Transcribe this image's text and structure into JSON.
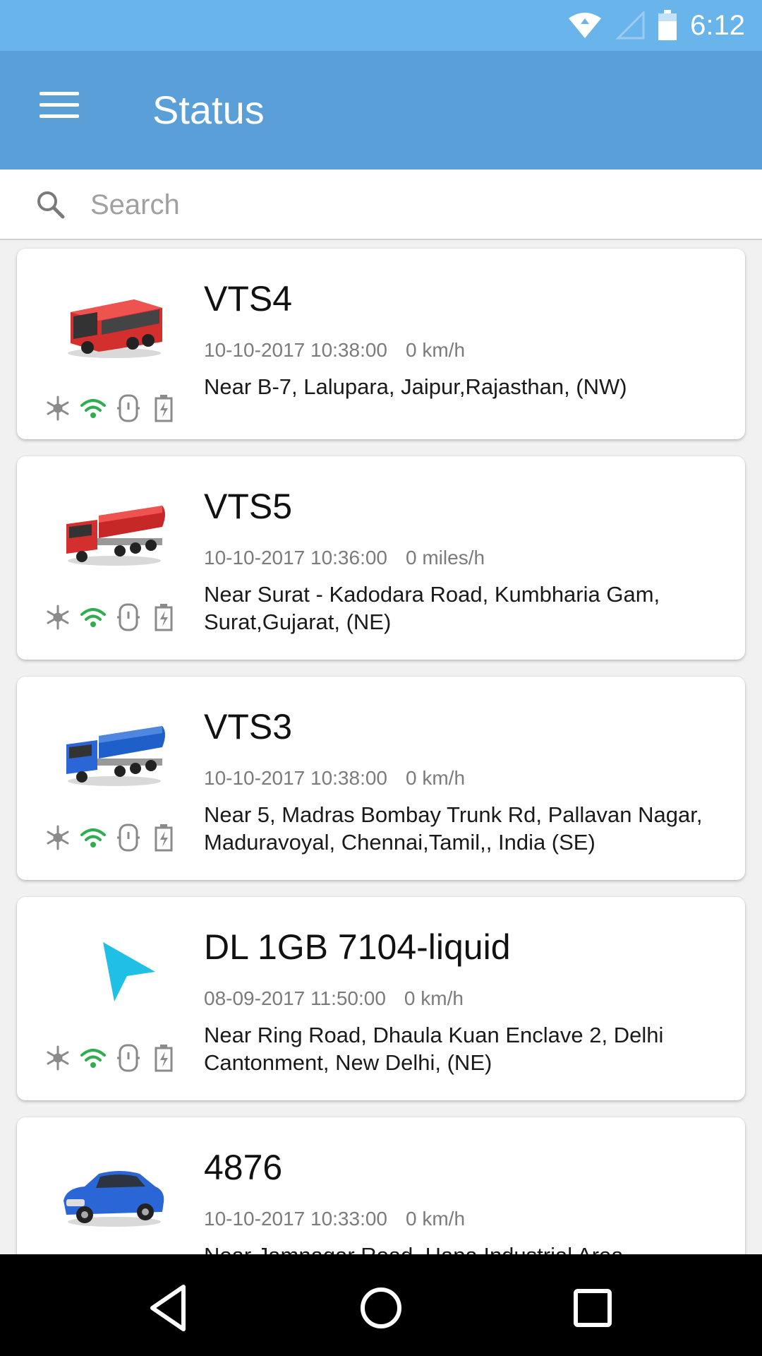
{
  "status_bar": {
    "time": "6:12",
    "icons": [
      "wifi-icon",
      "cell-signal-icon",
      "battery-icon"
    ]
  },
  "header": {
    "title": "Status",
    "menu_icon": "hamburger-menu-icon"
  },
  "search": {
    "placeholder": "Search",
    "value": "",
    "icon": "search-icon"
  },
  "vehicles": [
    {
      "name": "VTS4",
      "datetime": "10-10-2017 10:38:00",
      "speed": "0 km/h",
      "address": "Near B-7, Lalupara, Jaipur,Rajasthan, (NW)",
      "icon": "red-bus-icon",
      "color": "#d32f2f"
    },
    {
      "name": "VTS5",
      "datetime": "10-10-2017 10:36:00",
      "speed": "0 miles/h",
      "address": "Near Surat - Kadodara Road, Kumbharia Gam, Surat,Gujarat, (NE)",
      "icon": "red-tanker-truck-icon",
      "color": "#d32f2f"
    },
    {
      "name": "VTS3",
      "datetime": "10-10-2017 10:38:00",
      "speed": "0 km/h",
      "address": "Near 5, Madras Bombay Trunk Rd, Pallavan Nagar, Maduravoyal, Chennai,Tamil,, India (SE)",
      "icon": "blue-tanker-truck-icon",
      "color": "#1e5fc9"
    },
    {
      "name": "DL 1GB 7104-liquid",
      "datetime": "08-09-2017 11:50:00",
      "speed": "0 km/h",
      "address": "Near Ring Road, Dhaula Kuan Enclave 2, Delhi Cantonment, New Delhi, (NE)",
      "icon": "navigation-arrow-icon",
      "color": "#1fbfe6"
    },
    {
      "name": "4876",
      "datetime": "10-10-2017 10:33:00",
      "speed": "0 km/h",
      "address": "Near Jamnagar Road, Hapa Industrial Area",
      "icon": "blue-car-icon",
      "color": "#2a66d6"
    }
  ],
  "status_icon_names": [
    "ac-snowflake-icon",
    "gps-signal-icon",
    "ignition-icon",
    "battery-charge-icon"
  ],
  "nav": {
    "back": "back-icon",
    "home": "home-icon",
    "recents": "recents-icon"
  }
}
